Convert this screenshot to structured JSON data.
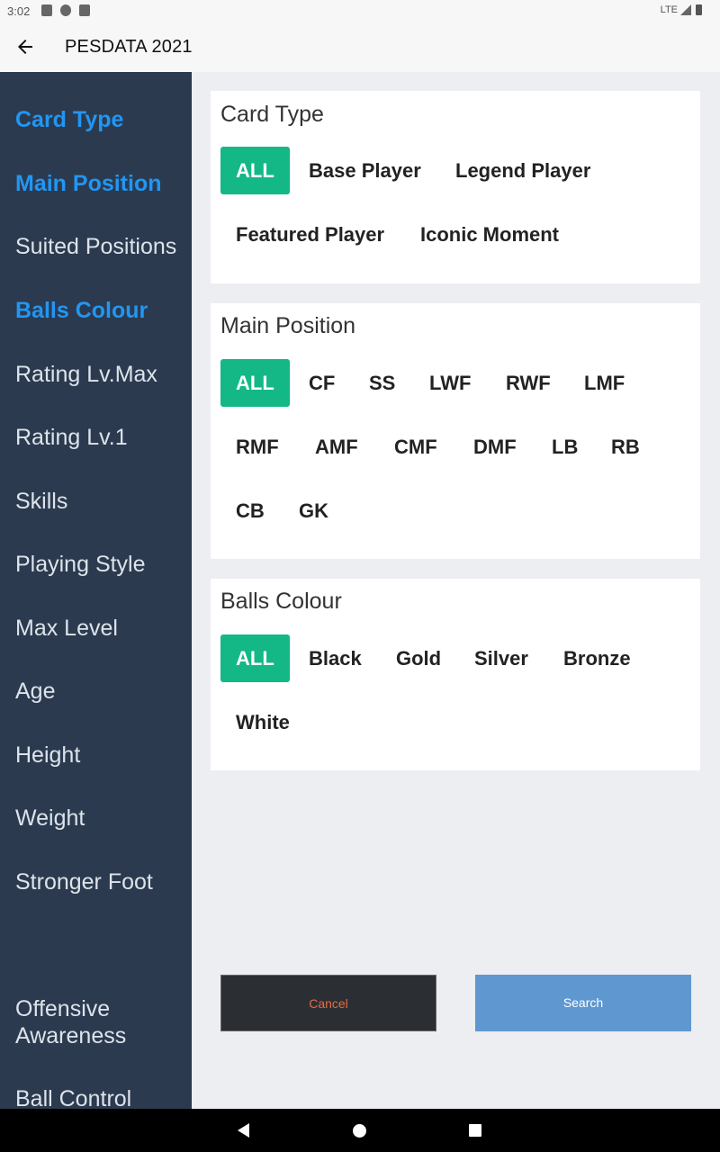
{
  "status_bar": {
    "time": "3:02",
    "network": "LTE"
  },
  "app_bar": {
    "title": "PESDATA 2021",
    "back_icon": "arrow-left-icon"
  },
  "sidebar": {
    "items": [
      {
        "label": "Card Type",
        "active": true
      },
      {
        "label": "Main Position",
        "active": true
      },
      {
        "label": "Suited Positions",
        "active": false
      },
      {
        "label": "Balls Colour",
        "active": true
      },
      {
        "label": "Rating Lv.Max",
        "active": false
      },
      {
        "label": "Rating Lv.1",
        "active": false
      },
      {
        "label": "Skills",
        "active": false
      },
      {
        "label": "Playing Style",
        "active": false
      },
      {
        "label": "Max Level",
        "active": false
      },
      {
        "label": "Age",
        "active": false
      },
      {
        "label": "Height",
        "active": false
      },
      {
        "label": "Weight",
        "active": false
      },
      {
        "label": "Stronger Foot",
        "active": false
      },
      {
        "label": "Offensive Awareness",
        "active": false
      },
      {
        "label": "Ball Control",
        "active": false
      }
    ]
  },
  "filters": {
    "card_type": {
      "title": "Card Type",
      "options": [
        "ALL",
        "Base Player",
        "Legend Player",
        "Featured Player",
        "Iconic Moment"
      ],
      "selected": "ALL"
    },
    "main_position": {
      "title": "Main Position",
      "options": [
        "ALL",
        "CF",
        "SS",
        "LWF",
        "RWF",
        "LMF",
        "RMF",
        "AMF",
        "CMF",
        "DMF",
        "LB",
        "RB",
        "CB",
        "GK"
      ],
      "selected": "ALL"
    },
    "balls_colour": {
      "title": "Balls Colour",
      "options": [
        "ALL",
        "Black",
        "Gold",
        "Silver",
        "Bronze",
        "White"
      ],
      "selected": "ALL"
    }
  },
  "actions": {
    "cancel_label": "Cancel",
    "search_label": "Search"
  },
  "colors": {
    "sidebar_bg": "#2b3a4f",
    "active_blue": "#2196f3",
    "chip_selected": "#13b886",
    "search_button": "#5f97d1",
    "cancel_text": "#e46b45"
  }
}
